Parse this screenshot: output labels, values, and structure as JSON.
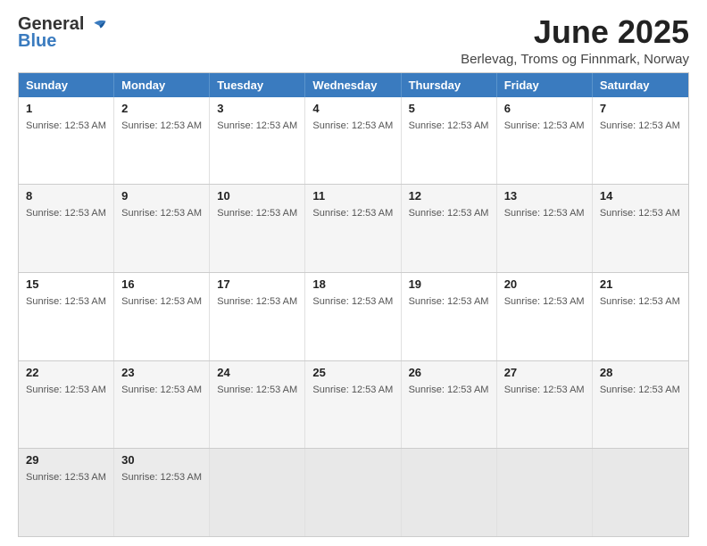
{
  "header": {
    "logo_general": "General",
    "logo_blue": "Blue",
    "month_title": "June 2025",
    "location": "Berlevag, Troms og Finnmark, Norway"
  },
  "calendar": {
    "days_of_week": [
      "Sunday",
      "Monday",
      "Tuesday",
      "Wednesday",
      "Thursday",
      "Friday",
      "Saturday"
    ],
    "sunrise_text": "Sunrise: 12:53 AM",
    "weeks": [
      [
        {
          "day": "1",
          "sunrise": "Sunrise: 12:53 AM"
        },
        {
          "day": "2",
          "sunrise": "Sunrise: 12:53 AM"
        },
        {
          "day": "3",
          "sunrise": "Sunrise: 12:53 AM"
        },
        {
          "day": "4",
          "sunrise": "Sunrise: 12:53 AM"
        },
        {
          "day": "5",
          "sunrise": "Sunrise: 12:53 AM"
        },
        {
          "day": "6",
          "sunrise": "Sunrise: 12:53 AM"
        },
        {
          "day": "7",
          "sunrise": "Sunrise: 12:53 AM"
        }
      ],
      [
        {
          "day": "8",
          "sunrise": "Sunrise: 12:53 AM"
        },
        {
          "day": "9",
          "sunrise": "Sunrise: 12:53 AM"
        },
        {
          "day": "10",
          "sunrise": "Sunrise: 12:53 AM"
        },
        {
          "day": "11",
          "sunrise": "Sunrise: 12:53 AM"
        },
        {
          "day": "12",
          "sunrise": "Sunrise: 12:53 AM"
        },
        {
          "day": "13",
          "sunrise": "Sunrise: 12:53 AM"
        },
        {
          "day": "14",
          "sunrise": "Sunrise: 12:53 AM"
        }
      ],
      [
        {
          "day": "15",
          "sunrise": "Sunrise: 12:53 AM"
        },
        {
          "day": "16",
          "sunrise": "Sunrise: 12:53 AM"
        },
        {
          "day": "17",
          "sunrise": "Sunrise: 12:53 AM"
        },
        {
          "day": "18",
          "sunrise": "Sunrise: 12:53 AM"
        },
        {
          "day": "19",
          "sunrise": "Sunrise: 12:53 AM"
        },
        {
          "day": "20",
          "sunrise": "Sunrise: 12:53 AM"
        },
        {
          "day": "21",
          "sunrise": "Sunrise: 12:53 AM"
        }
      ],
      [
        {
          "day": "22",
          "sunrise": "Sunrise: 12:53 AM"
        },
        {
          "day": "23",
          "sunrise": "Sunrise: 12:53 AM"
        },
        {
          "day": "24",
          "sunrise": "Sunrise: 12:53 AM"
        },
        {
          "day": "25",
          "sunrise": "Sunrise: 12:53 AM"
        },
        {
          "day": "26",
          "sunrise": "Sunrise: 12:53 AM"
        },
        {
          "day": "27",
          "sunrise": "Sunrise: 12:53 AM"
        },
        {
          "day": "28",
          "sunrise": "Sunrise: 12:53 AM"
        }
      ],
      [
        {
          "day": "29",
          "sunrise": "Sunrise: 12:53 AM"
        },
        {
          "day": "30",
          "sunrise": "Sunrise: 12:53 AM"
        },
        {
          "day": "",
          "sunrise": ""
        },
        {
          "day": "",
          "sunrise": ""
        },
        {
          "day": "",
          "sunrise": ""
        },
        {
          "day": "",
          "sunrise": ""
        },
        {
          "day": "",
          "sunrise": ""
        }
      ]
    ]
  }
}
